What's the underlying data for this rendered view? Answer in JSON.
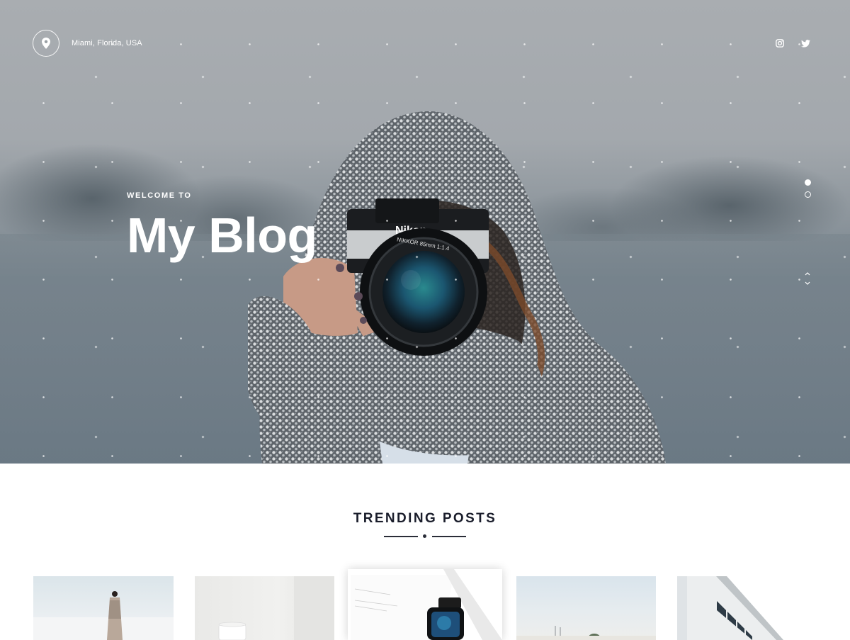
{
  "header": {
    "location": "Miami, Florida, USA",
    "location_icon": "map-pin-icon",
    "social": [
      {
        "name": "instagram",
        "icon": "instagram-icon"
      },
      {
        "name": "twitter",
        "icon": "twitter-icon"
      }
    ]
  },
  "hero": {
    "kicker": "WELCOME TO",
    "title": "My Blog",
    "slides_total": 2,
    "active_slide": 1,
    "photo_camera_brand": "Nikon",
    "photo_lens_text": "NIKKOR 85mm 1:1.4"
  },
  "trending": {
    "title": "TRENDING POSTS",
    "posts": [
      {
        "image": "woman-on-beach"
      },
      {
        "image": "white-mug"
      },
      {
        "image": "smartwatch-flatlay"
      },
      {
        "image": "beach-horizon"
      },
      {
        "image": "modern-building"
      }
    ]
  },
  "colors": {
    "heading": "#1a1d2b",
    "hero_text": "#ffffff"
  }
}
